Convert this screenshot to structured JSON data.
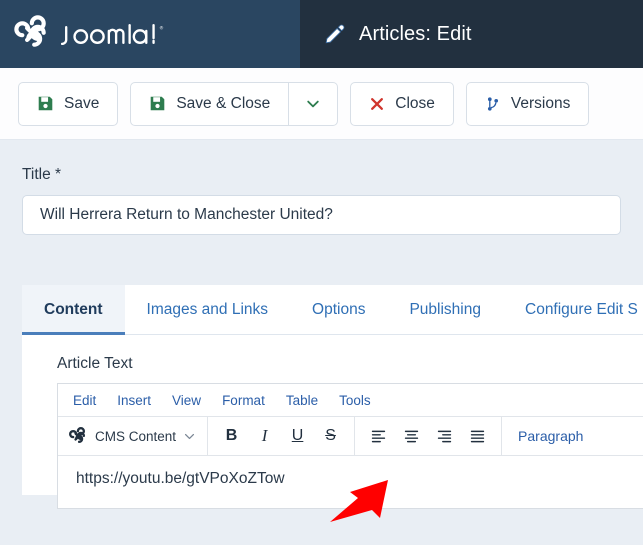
{
  "header": {
    "brand_name": "Joomla!",
    "brand_logo_icon": "joomla-logo-icon",
    "page_icon": "pencil-edit-icon",
    "title": "Articles: Edit",
    "brand_bg_color": "#2a4661",
    "title_bg_color": "#22303f"
  },
  "toolbar": {
    "save_label": "Save",
    "save_icon": "floppy-disk-save-icon",
    "save_close_label": "Save & Close",
    "save_close_icon": "floppy-disk-save-icon",
    "save_dropdown_icon": "chevron-down-icon",
    "close_label": "Close",
    "close_icon": "x-mark-icon",
    "versions_label": "Versions",
    "versions_icon": "code-branch-icon",
    "save_icon_color": "#2e7d4f",
    "close_icon_color": "#d0342c",
    "versions_icon_color": "#2b5ea8"
  },
  "form": {
    "title_label": "Title *",
    "title_value": "Will Herrera Return to Manchester United?"
  },
  "tabs": [
    {
      "label": "Content",
      "active": true
    },
    {
      "label": "Images and Links",
      "active": false
    },
    {
      "label": "Options",
      "active": false
    },
    {
      "label": "Publishing",
      "active": false
    },
    {
      "label": "Configure Edit S",
      "active": false
    }
  ],
  "editor": {
    "field_label": "Article Text",
    "menubar": [
      "Edit",
      "Insert",
      "View",
      "Format",
      "Table",
      "Tools"
    ],
    "cms_content_label": "CMS Content",
    "cms_content_icon": "joomla-mark-icon",
    "cms_content_caret_icon": "chevron-down-icon",
    "format_buttons": [
      {
        "name": "bold-button",
        "glyph": "B",
        "style": "bold"
      },
      {
        "name": "italic-button",
        "glyph": "I",
        "style": "italic"
      },
      {
        "name": "underline-button",
        "glyph": "U",
        "style": "underline"
      },
      {
        "name": "strikethrough-button",
        "glyph": "S",
        "style": "strike"
      }
    ],
    "align_buttons": [
      {
        "name": "align-left-button",
        "icon": "align-left-icon"
      },
      {
        "name": "align-center-button",
        "icon": "align-center-icon"
      },
      {
        "name": "align-right-button",
        "icon": "align-right-icon"
      },
      {
        "name": "align-justify-button",
        "icon": "align-justify-icon"
      }
    ],
    "paragraph_label": "Paragraph",
    "content_text": "https://youtu.be/gtVPoXoZTow"
  },
  "annotation": {
    "arrow_icon": "red-arrow-pointing-down-left",
    "arrow_color": "#ff0000"
  }
}
